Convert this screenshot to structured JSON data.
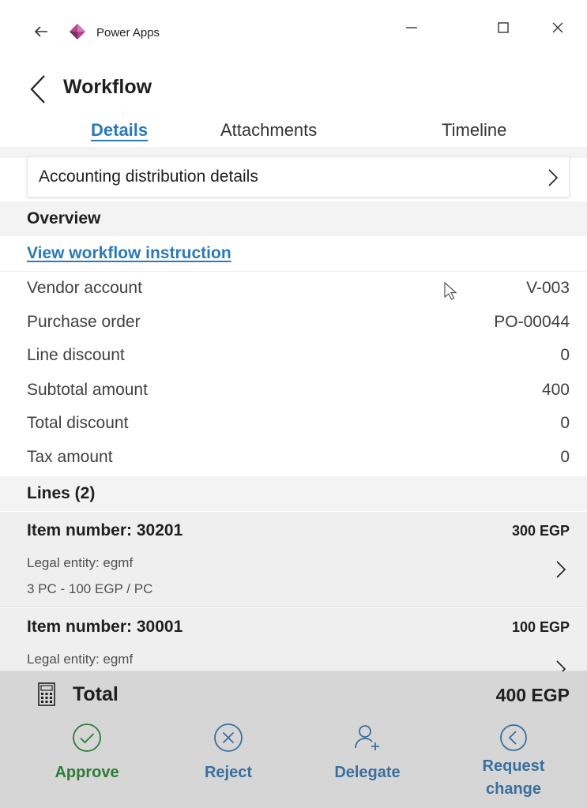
{
  "window": {
    "app_title": "Power Apps",
    "controls": [
      "minimize",
      "maximize",
      "close"
    ]
  },
  "header": {
    "title": "Workflow"
  },
  "tabs": [
    {
      "label": "Details",
      "active": true
    },
    {
      "label": "Attachments",
      "active": false
    },
    {
      "label": "Timeline",
      "active": false
    }
  ],
  "accounting": {
    "label": "Accounting distribution details"
  },
  "overview": {
    "heading": "Overview",
    "link_label": "View workflow instruction",
    "rows": [
      {
        "label": "Vendor account",
        "value": "V-003"
      },
      {
        "label": "Purchase order",
        "value": "PO-00044"
      },
      {
        "label": "Line discount",
        "value": "0"
      },
      {
        "label": "Subtotal amount",
        "value": "400"
      },
      {
        "label": "Total discount",
        "value": "0"
      },
      {
        "label": "Tax amount",
        "value": "0"
      }
    ]
  },
  "lines": {
    "heading": "Lines (2)",
    "items": [
      {
        "title": "Item number: 30201",
        "amount": "300 EGP",
        "entity": "Legal entity: egmf",
        "detail": "3 PC - 100 EGP / PC"
      },
      {
        "title": "Item number: 30001",
        "amount": "100 EGP",
        "entity": "Legal entity: egmf"
      }
    ]
  },
  "footer": {
    "total_label": "Total",
    "total_amount": "400 EGP",
    "actions": [
      {
        "label": "Approve",
        "color": "#2f7a36"
      },
      {
        "label": "Reject",
        "color": "#3a6f9e"
      },
      {
        "label": "Delegate",
        "color": "#3a6f9e"
      },
      {
        "label_line1": "Request",
        "label_line2": "change",
        "color": "#3a6f9e"
      }
    ]
  },
  "colors": {
    "link": "#2a7ab9",
    "section_bg": "#f3f3f3",
    "footer_bg": "#d6d6d6",
    "logo": "#b4458f"
  }
}
